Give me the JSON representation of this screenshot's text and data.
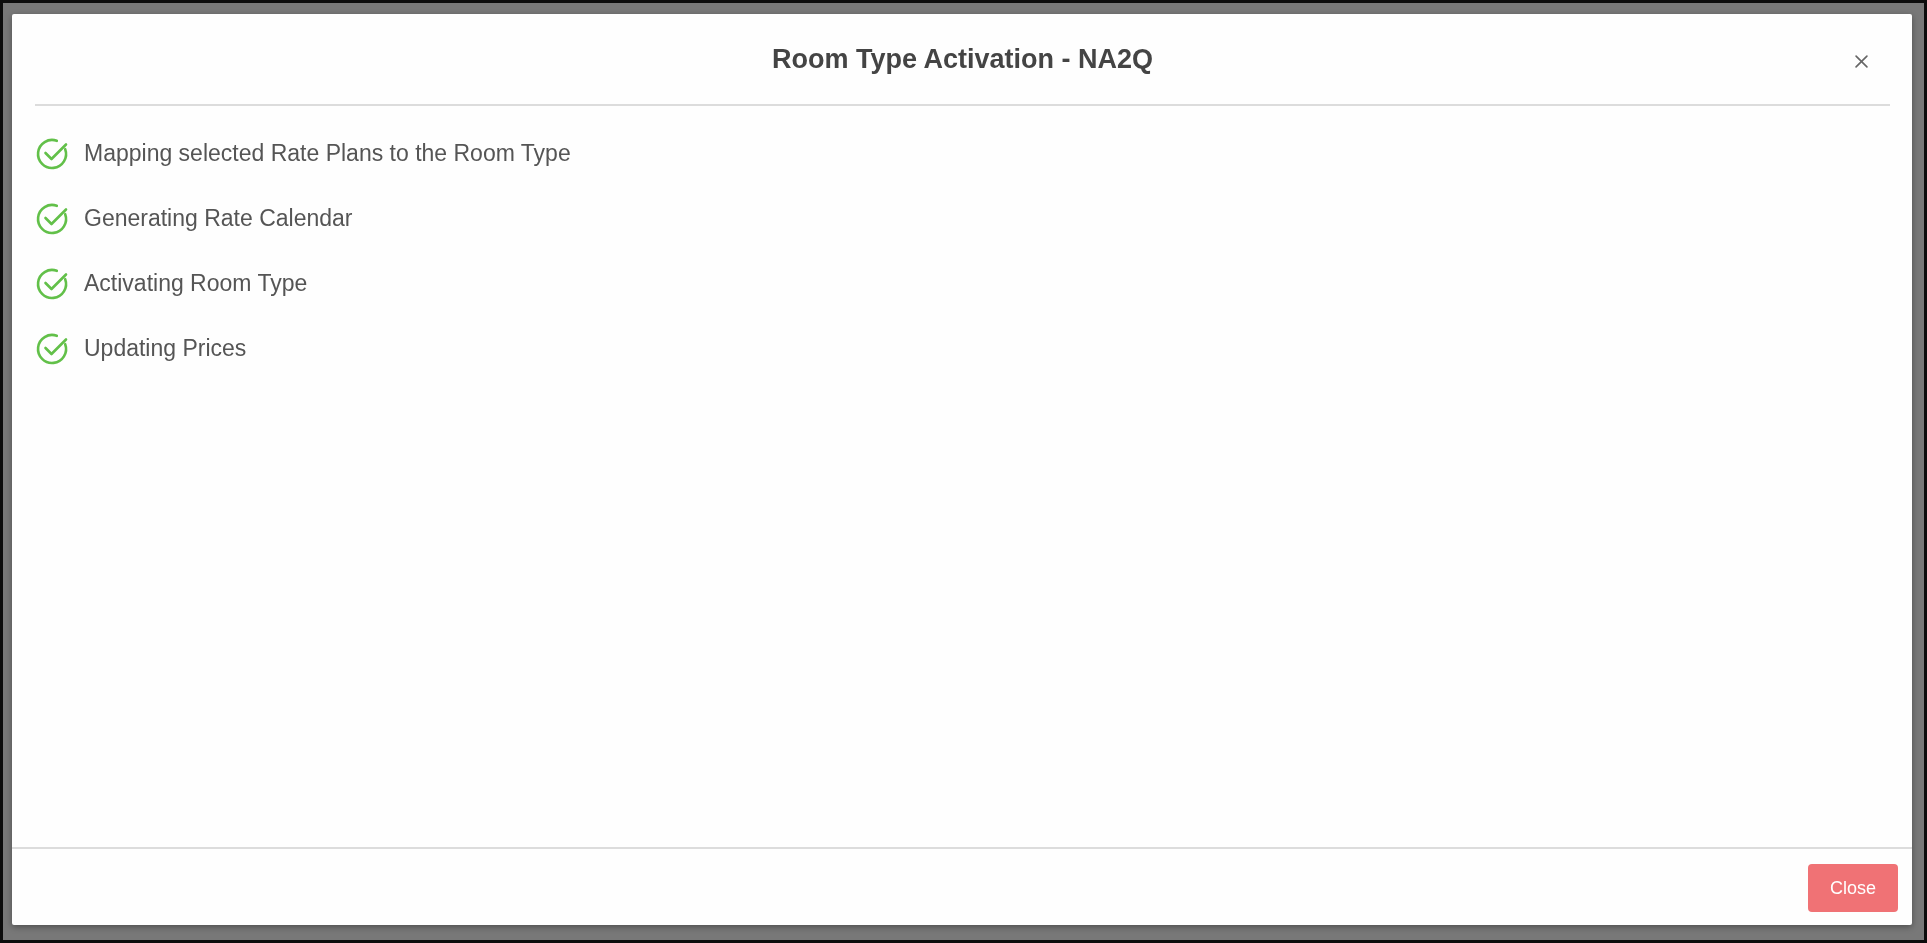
{
  "dialog": {
    "title": "Room Type Activation - NA2Q"
  },
  "steps": [
    {
      "label": "Mapping selected Rate Plans to the Room Type",
      "done": true
    },
    {
      "label": "Generating Rate Calendar",
      "done": true
    },
    {
      "label": "Activating Room Type",
      "done": true
    },
    {
      "label": "Updating Prices",
      "done": true
    }
  ],
  "footer": {
    "buttons": [
      "Close"
    ]
  }
}
